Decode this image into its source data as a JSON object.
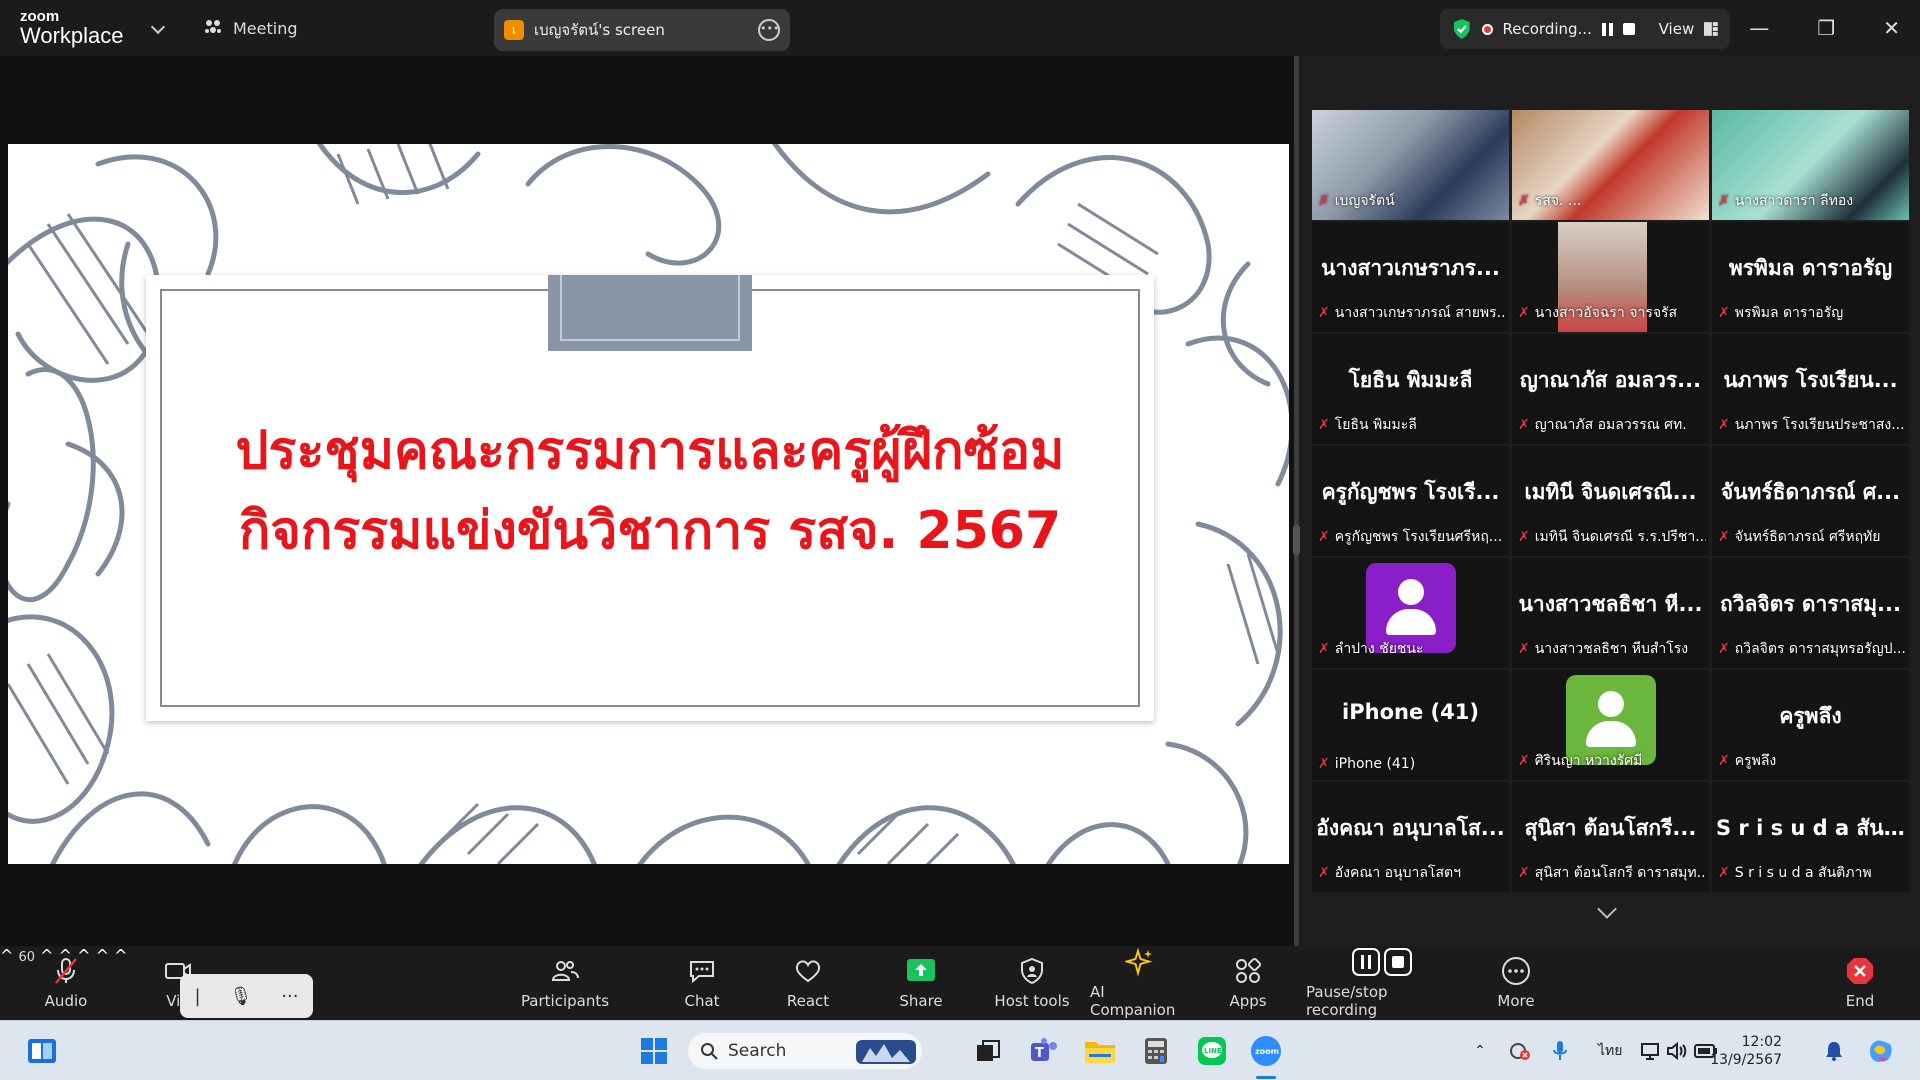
{
  "app": {
    "brand_top": "zoom",
    "brand_bottom": "Workplace",
    "meeting_label": "Meeting"
  },
  "share": {
    "avatar_letter": "เ",
    "screen_name": "เบญจรัตน์'s screen"
  },
  "recording": {
    "label": "Recording...",
    "view_label": "View"
  },
  "slide": {
    "title_line1": "ประชุมคณะกรรมการและครูผู้ฝึกซ้อม",
    "title_line2": "กิจกรรมแข่งขันวิชาการ รสจ. 2567",
    "title_color": "#e8151b"
  },
  "gallery": [
    {
      "big": "",
      "label": "เบญจรัตน์",
      "video": true
    },
    {
      "big": "",
      "label": "รสจ. ...",
      "video": true
    },
    {
      "big": "",
      "label": "นางสาวดารา ลีทอง",
      "video": true
    },
    {
      "big": "นางสาวเกษราภร...",
      "label": "นางสาวเกษราภรณ์ สายพร..."
    },
    {
      "big": "",
      "label": "นางสาวอัจฉรา จารจรัส",
      "video": true
    },
    {
      "big": "พรพิมล ดาราอรัญ",
      "label": "พรพิมล ดาราอรัญ"
    },
    {
      "big": "โยธิน พิมมะลี",
      "label": "โยธิน พิมมะลี"
    },
    {
      "big": "ญาณาภัส อมลวร...",
      "label": "ญาณาภัส อมลวรรณ ศท."
    },
    {
      "big": "นภาพร โรงเรียน...",
      "label": "นภาพร โรงเรียนประชาสง..."
    },
    {
      "big": "ครูกัญชพร โรงเรี...",
      "label": "ครูกัญชพร โรงเรียนศรีหฤ..."
    },
    {
      "big": "เมทินี จินดเศรณี...",
      "label": "เมทินี จินดเศรณี ร.ร.ปรีชา..."
    },
    {
      "big": "จันทร์ธิดาภรณ์ ศ...",
      "label": "จันทร์ธิดาภรณ์ ศรีหฤทัย"
    },
    {
      "big": "",
      "label": "ลำปาง ชัยชนะ",
      "avatar": "#8a1fc9"
    },
    {
      "big": "นางสาวชลธิชา หี...",
      "label": "นางสาวชลธิชา หีบสำโรง"
    },
    {
      "big": "ถวิลจิตร ดาราสมุ...",
      "label": "ถวิลจิตร ดาราสมุทรอรัญป..."
    },
    {
      "big": "iPhone (41)",
      "label": "iPhone (41)"
    },
    {
      "big": "",
      "label": "ศิรินญา หวางรัศมี",
      "avatar": "#6bb63c"
    },
    {
      "big": "ครูพลึง",
      "label": "ครูพลึง"
    },
    {
      "big": "อังคณา อนุบาลโส...",
      "label": "อังคณา อนุบาลโสตฯ"
    },
    {
      "big": "สุนิสา ต้อนโสกรี...",
      "label": "สุนิสา ต้อนโสกรี ดาราสมุท..."
    },
    {
      "big": "S r i s u d a สันติ...",
      "label": "S r i s u d a สันติภาพ"
    }
  ],
  "toolbar": {
    "audio": "Audio",
    "video": "Vid",
    "participants": "Participants",
    "participants_count": "60",
    "chat": "Chat",
    "react": "React",
    "share": "Share",
    "host_tools": "Host tools",
    "ai_companion": "AI Companion",
    "apps": "Apps",
    "pause_stop": "Pause/stop recording",
    "more": "More",
    "end": "End"
  },
  "taskbar": {
    "search": "Search",
    "lang": "ไทย",
    "time": "12:02",
    "date": "13/9/2567"
  },
  "colors": {
    "accent_green": "#35d17a",
    "recording_red": "#e8343c",
    "share_green": "#19c25a",
    "end_red": "#e8343c"
  }
}
